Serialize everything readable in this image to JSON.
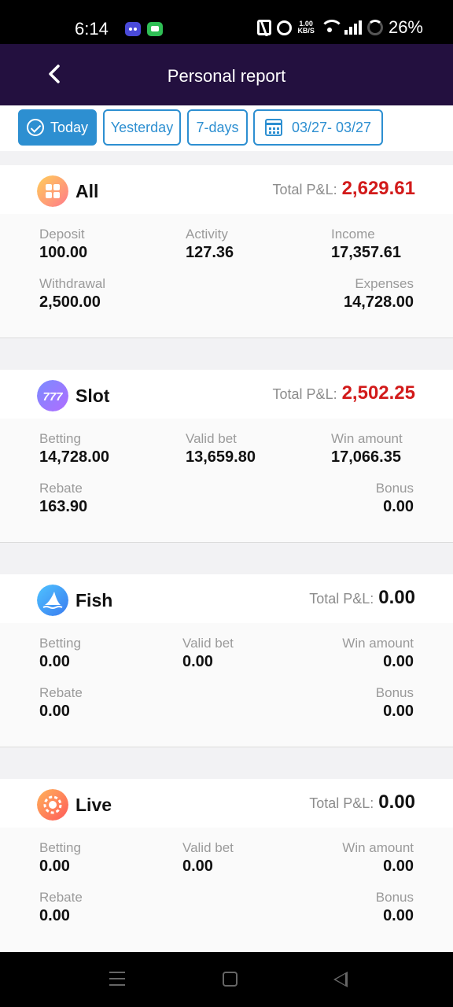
{
  "status_bar": {
    "time": "6:14",
    "net_speed_value": "1.00",
    "net_speed_unit": "KB/S",
    "battery": "26%"
  },
  "header": {
    "title": "Personal report",
    "back_icon": "chevron-left-icon"
  },
  "filters": {
    "today": "Today",
    "yesterday": "Yesterday",
    "seven_days": "7-days",
    "date_range": "03/27- 03/27",
    "active": "today",
    "accent_color": "#2d8fd1"
  },
  "pnl_label": "Total P&L:",
  "colors": {
    "header_bg": "#23103f",
    "negative_or_highlight": "#d21a1a"
  },
  "cards": {
    "all": {
      "name": "All",
      "icon": "grid-icon",
      "pnl": "2,629.61",
      "stats": [
        {
          "label": "Deposit",
          "value": "100.00"
        },
        {
          "label": "Activity",
          "value": "127.36"
        },
        {
          "label": "Income",
          "value": "17,357.61"
        },
        {
          "label": "Withdrawal",
          "value": "2,500.00"
        },
        {
          "label": "Expenses",
          "value": "14,728.00"
        }
      ]
    },
    "slot": {
      "name": "Slot",
      "icon": "slot-777-icon",
      "pnl": "2,502.25",
      "stats": [
        {
          "label": "Betting",
          "value": "14,728.00"
        },
        {
          "label": "Valid bet",
          "value": "13,659.80"
        },
        {
          "label": "Win amount",
          "value": "17,066.35"
        },
        {
          "label": "Rebate",
          "value": "163.90"
        },
        {
          "label": "Bonus",
          "value": "0.00"
        }
      ]
    },
    "fish": {
      "name": "Fish",
      "icon": "shark-fin-icon",
      "pnl": "0.00",
      "stats": [
        {
          "label": "Betting",
          "value": "0.00"
        },
        {
          "label": "Valid bet",
          "value": "0.00"
        },
        {
          "label": "Win amount",
          "value": "0.00"
        },
        {
          "label": "Rebate",
          "value": "0.00"
        },
        {
          "label": "Bonus",
          "value": "0.00"
        }
      ]
    },
    "live": {
      "name": "Live",
      "icon": "casino-chip-icon",
      "pnl": "0.00",
      "stats": [
        {
          "label": "Betting",
          "value": "0.00"
        },
        {
          "label": "Valid bet",
          "value": "0.00"
        },
        {
          "label": "Win amount",
          "value": "0.00"
        },
        {
          "label": "Rebate",
          "value": "0.00"
        },
        {
          "label": "Bonus",
          "value": "0.00"
        }
      ]
    }
  }
}
